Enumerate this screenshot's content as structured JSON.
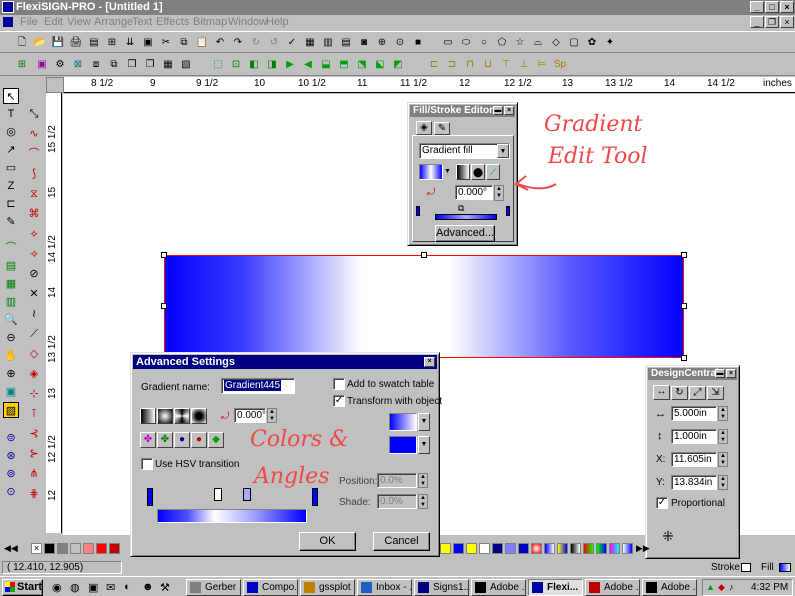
{
  "window": {
    "title": "FlexiSIGN-PRO - [Untitled 1]",
    "min": "_",
    "max": "□",
    "close": "×"
  },
  "menu": [
    "File",
    "Edit",
    "View",
    "Arrange",
    "Text",
    "Effects",
    "Bitmap",
    "Window",
    "Help"
  ],
  "ruler": {
    "top_labels": [
      "8 1/2",
      "9",
      "9 1/2",
      "10",
      "10 1/2",
      "11",
      "11 1/2",
      "12",
      "12 1/2",
      "13",
      "13 1/2",
      "14",
      "14 1/2",
      "inches"
    ],
    "left_labels": [
      "15 1/2",
      "15",
      "14 1/2",
      "14",
      "13 1/2",
      "13",
      "12 1/2",
      "12"
    ]
  },
  "fill_stroke_editor": {
    "title": "Fill/Stroke Editor",
    "fill_type": "Gradient fill",
    "angle": "0.000°",
    "advanced_button": "Advanced..."
  },
  "annotations": {
    "gradient_tool": "Gradient",
    "gradient_tool_2": "Edit Tool",
    "colors_angles": "Colors &",
    "colors_angles_2": "Angles"
  },
  "advanced_settings": {
    "title": "Advanced Settings",
    "gradient_name_label": "Gradient name:",
    "gradient_name": "Gradient445",
    "add_to_swatch": "Add to swatch table",
    "add_to_swatch_checked": false,
    "transform_with_object": "Transform with object",
    "transform_checked": true,
    "angle": "0.000°",
    "use_hsv": "Use HSV transition",
    "use_hsv_checked": false,
    "position_label": "Position:",
    "position_value": "0.0%",
    "shade_label": "Shade:",
    "shade_value": "0.0%",
    "ok": "OK",
    "cancel": "Cancel"
  },
  "design_central": {
    "title": "DesignCentral",
    "width": "5.000in",
    "height": "1.000in",
    "x_label": "X:",
    "x": "11.605in",
    "y_label": "Y:",
    "y": "13.834in",
    "proportional": "Proportional",
    "proportional_checked": true
  },
  "status": {
    "coords": "( 12.410,    12.905)",
    "stroke": "Stroke",
    "fill": "Fill"
  },
  "taskbar": {
    "start": "Start",
    "tasks": [
      "Gerber ...",
      "Compo...",
      "gssplot",
      "Inbox - ...",
      "Signs1...",
      "Adobe ...",
      "Flexi...",
      "Adobe ...",
      "Adobe ..."
    ],
    "clock": "4:32 PM"
  },
  "colors": {
    "gradient_blue": "#0000ff",
    "annotation_red": "#f04848",
    "title_active": "#000080"
  }
}
